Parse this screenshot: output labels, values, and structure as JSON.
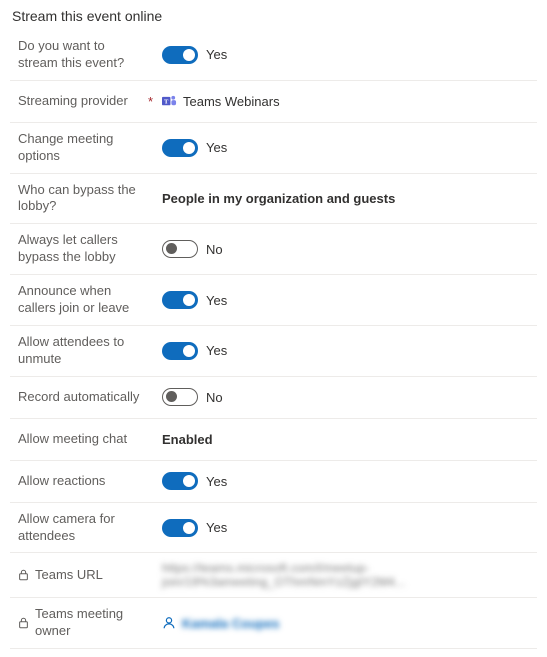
{
  "section_title": "Stream this event online",
  "rows": {
    "stream_event": {
      "label": "Do you want to stream this event?",
      "on": true,
      "text": "Yes"
    },
    "provider": {
      "label": "Streaming provider",
      "required": "*",
      "value": "Teams Webinars"
    },
    "change_options": {
      "label": "Change meeting options",
      "on": true,
      "text": "Yes"
    },
    "bypass_lobby": {
      "label": "Who can bypass the lobby?",
      "value": "People in my organization and guests"
    },
    "always_bypass": {
      "label": "Always let callers bypass the lobby",
      "on": false,
      "text": "No"
    },
    "announce": {
      "label": "Announce when callers join or leave",
      "on": true,
      "text": "Yes"
    },
    "unmute": {
      "label": "Allow attendees to unmute",
      "on": true,
      "text": "Yes"
    },
    "record": {
      "label": "Record automatically",
      "on": false,
      "text": "No"
    },
    "chat": {
      "label": "Allow meeting chat",
      "value": "Enabled"
    },
    "reactions": {
      "label": "Allow reactions",
      "on": true,
      "text": "Yes"
    },
    "camera": {
      "label": "Allow camera for attendees",
      "on": true,
      "text": "Yes"
    },
    "url": {
      "label": "Teams URL",
      "value": "https://teams.microsoft.com/l/meetup-join/19%3ameeting_OThmNmYzZjgtY2M4..."
    },
    "owner": {
      "label": "Teams meeting owner",
      "value": "Kamala Coupes"
    }
  }
}
